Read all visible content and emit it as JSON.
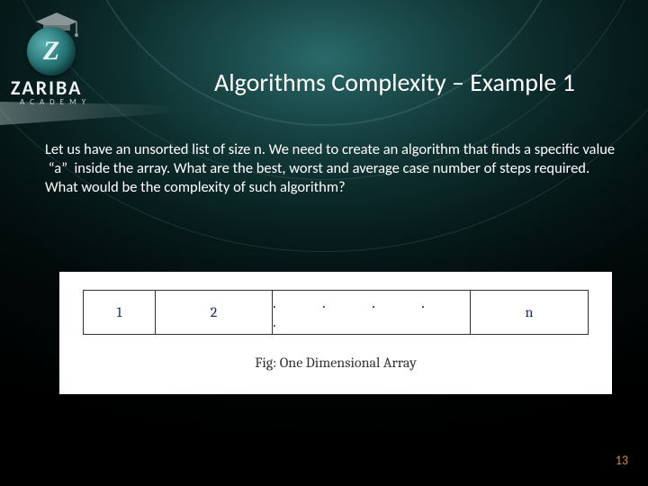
{
  "brand": {
    "z": "Z",
    "name": "ZARIBA",
    "subtitle": "ACADEMY"
  },
  "slide": {
    "title": "Algorithms Complexity – Example 1",
    "para1": "Let us have an unsorted list of size n. We need to create an algorithm that finds a specific value  “a”  inside the array. What are the best, worst and average case number of steps required.",
    "para2": "What would be the complexity of such algorithm?",
    "page": "13"
  },
  "figure": {
    "cell1": "1",
    "cell2": "2",
    "dots": ".   .   .   .   .",
    "celln": "n",
    "caption": "Fig: One Dimensional Array"
  }
}
